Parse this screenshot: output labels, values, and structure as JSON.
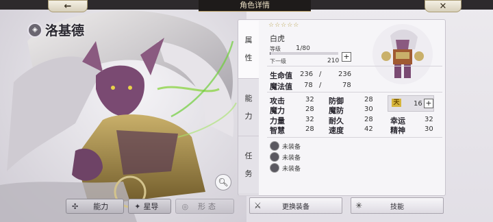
{
  "header": {
    "title": "角色详情",
    "back_icon": "←",
    "close_icon": "✕"
  },
  "character": {
    "name": "洛基德",
    "class_name": "白虎",
    "stars": "☆☆☆☆☆"
  },
  "side_tabs": [
    {
      "label": "属\n性"
    },
    {
      "label": "能\n力"
    },
    {
      "label": "任\n务"
    }
  ],
  "level": {
    "label": "等级",
    "value": "1",
    "max": "80",
    "next_label": "下一级",
    "next_value": "210",
    "progress": 0.01
  },
  "vitals": {
    "hp_label": "生命值",
    "hp_cur": "236",
    "hp_sep": "/",
    "hp_max": "236",
    "mp_label": "魔法值",
    "mp_cur": "78",
    "mp_sep": "/",
    "mp_max": "78"
  },
  "stats": {
    "row1": [
      {
        "label": "攻击",
        "value": "32"
      },
      {
        "label": "防御",
        "value": "28"
      }
    ],
    "row2": [
      {
        "label": "魔力",
        "value": "28"
      },
      {
        "label": "魔防",
        "value": "30"
      }
    ],
    "row3": [
      {
        "label": "力量",
        "value": "32"
      },
      {
        "label": "耐久",
        "value": "28"
      },
      {
        "label": "幸运",
        "value": "32"
      }
    ],
    "row4": [
      {
        "label": "智慧",
        "value": "28"
      },
      {
        "label": "速度",
        "value": "42"
      },
      {
        "label": "精神",
        "value": "30"
      }
    ],
    "luck_points": "16",
    "luck_icon": "天"
  },
  "equipment": [
    {
      "label": "未装备"
    },
    {
      "label": "未装备"
    },
    {
      "label": "未装备"
    }
  ],
  "bottom_left": [
    {
      "label": "能力",
      "icon": "✣"
    },
    {
      "label": "星导",
      "icon": "✦"
    },
    {
      "label": "形态",
      "icon": "◎"
    }
  ],
  "buttons": {
    "change_equip": "更换装备",
    "skills": "技能"
  },
  "colors": {
    "title_bar": "#1e1b1a",
    "accent_gold": "#b8a24c"
  }
}
